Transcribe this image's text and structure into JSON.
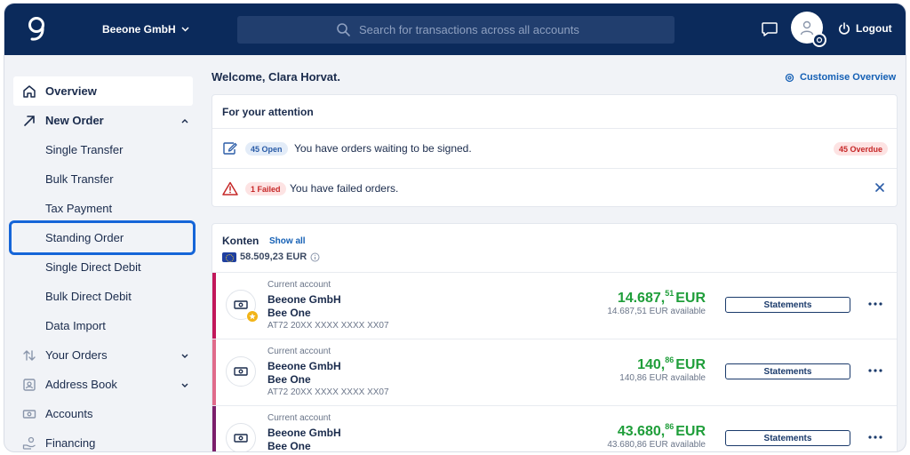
{
  "header": {
    "company": "Beeone GmbH",
    "search_placeholder": "Search for transactions across all accounts",
    "logout_label": "Logout"
  },
  "sidebar": {
    "items": [
      {
        "label": "Overview",
        "icon": "home-icon"
      },
      {
        "label": "New Order",
        "icon": "arrow-up-right-icon"
      },
      {
        "label": "Single Transfer"
      },
      {
        "label": "Bulk Transfer"
      },
      {
        "label": "Tax Payment"
      },
      {
        "label": "Standing Order"
      },
      {
        "label": "Single Direct Debit"
      },
      {
        "label": "Bulk Direct Debit"
      },
      {
        "label": "Data Import"
      },
      {
        "label": "Your Orders",
        "icon": "arrows-updown-icon"
      },
      {
        "label": "Address Book",
        "icon": "contact-card-icon"
      },
      {
        "label": "Accounts",
        "icon": "banknote-icon"
      },
      {
        "label": "Financing",
        "icon": "hand-coin-icon"
      }
    ]
  },
  "main": {
    "welcome": "Welcome, Clara Horvat.",
    "customise_label": "Customise Overview",
    "attention": {
      "title": "For your attention",
      "rows": [
        {
          "badge": "45 Open",
          "text": "You have orders waiting to be signed.",
          "right_badge": "45 Overdue"
        },
        {
          "badge": "1 Failed",
          "text": "You have failed orders."
        }
      ]
    },
    "konten": {
      "title": "Konten",
      "show_all": "Show all",
      "total": "58.509,23 EUR",
      "accounts": [
        {
          "type": "Current account",
          "holder": "Beeone GmbH",
          "name": "Bee One",
          "iban": "AT72 20XX XXXX XXXX XX07",
          "amount_main": "14.687,",
          "amount_cents": "51",
          "currency": "EUR",
          "available": "14.687,51 EUR available",
          "statements": "Statements",
          "stripe": "#c2185b"
        },
        {
          "type": "Current account",
          "holder": "Beeone GmbH",
          "name": "Bee One",
          "iban": "AT72 20XX XXXX XXXX XX07",
          "amount_main": "140,",
          "amount_cents": "86",
          "currency": "EUR",
          "available": "140,86 EUR available",
          "statements": "Statements",
          "stripe": "#e06b8b"
        },
        {
          "type": "Current account",
          "holder": "Beeone GmbH",
          "name": "Bee One",
          "iban": "",
          "amount_main": "43.680,",
          "amount_cents": "86",
          "currency": "EUR",
          "available": "43.680,86 EUR available",
          "statements": "Statements",
          "stripe": "#7b1f6b"
        }
      ]
    }
  }
}
